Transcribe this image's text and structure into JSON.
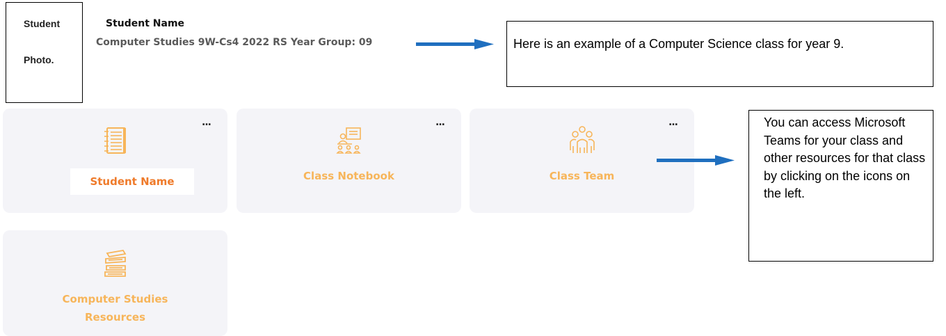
{
  "photo_placeholder": {
    "line1": "Student",
    "line2": "Photo."
  },
  "header": {
    "student_name": "Student Name",
    "class_info": "Computer Studies 9W-Cs4 2022 RS Year Group: 09"
  },
  "callouts": {
    "top": "Here is an example of a Computer Science class for year 9.",
    "right": "You can access Microsoft Teams for your class and other resources for that class by clicking on the icons on the left."
  },
  "tiles": [
    {
      "label": "Student Name",
      "icon": "notebook-icon",
      "more": "..."
    },
    {
      "label": "Class Notebook",
      "icon": "classroom-presentation-icon",
      "more": "..."
    },
    {
      "label": "Class Team",
      "icon": "team-people-icon",
      "more": "..."
    },
    {
      "label_line1": "Computer Studies",
      "label_line2": "Resources",
      "icon": "books-stack-icon"
    }
  ],
  "colors": {
    "arrow": "#1f6fbf",
    "tile_bg": "#f4f4f8",
    "tile_label": "#f7b55a",
    "name_badge_text": "#ef7b2b",
    "icon": "#f7b55a"
  }
}
